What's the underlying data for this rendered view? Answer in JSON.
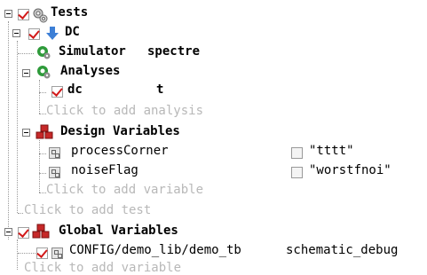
{
  "tree": {
    "tests": {
      "label": "Tests",
      "checked": true,
      "icon": "gears-icon",
      "test": {
        "label": "DC",
        "checked": true,
        "icon": "down-arrow-icon",
        "simulator": {
          "label": "Simulator",
          "value": "spectre",
          "icon": "green-gear-icon"
        },
        "analyses": {
          "label": "Analyses",
          "icon": "green-gear-icon",
          "items": [
            {
              "label": "dc",
              "value": "t",
              "checked": true
            }
          ],
          "add_hint": "Click to add analysis"
        },
        "design_variables": {
          "label": "Design Variables",
          "icon": "red-cubes-icon",
          "items": [
            {
              "name": "processCorner",
              "value": "\"tttt\"",
              "checked": false
            },
            {
              "name": "noiseFlag",
              "value": "\"worstfnoi\"",
              "checked": false
            }
          ],
          "add_hint": "Click to add variable"
        }
      },
      "add_hint": "Click to add test"
    },
    "global_variables": {
      "label": "Global Variables",
      "checked": true,
      "icon": "red-cubes-icon",
      "items": [
        {
          "name": "CONFIG/demo_lib/demo_tb",
          "value": "schematic_debug",
          "checked": true
        }
      ],
      "add_hint": "Click to add variable"
    }
  },
  "colors": {
    "check_red": "#d21a1a",
    "hint_grey": "#b8b8b8",
    "gear_green": "#2e9a3a",
    "cube_red": "#c62828",
    "arrow_blue": "#3d7fd6"
  }
}
